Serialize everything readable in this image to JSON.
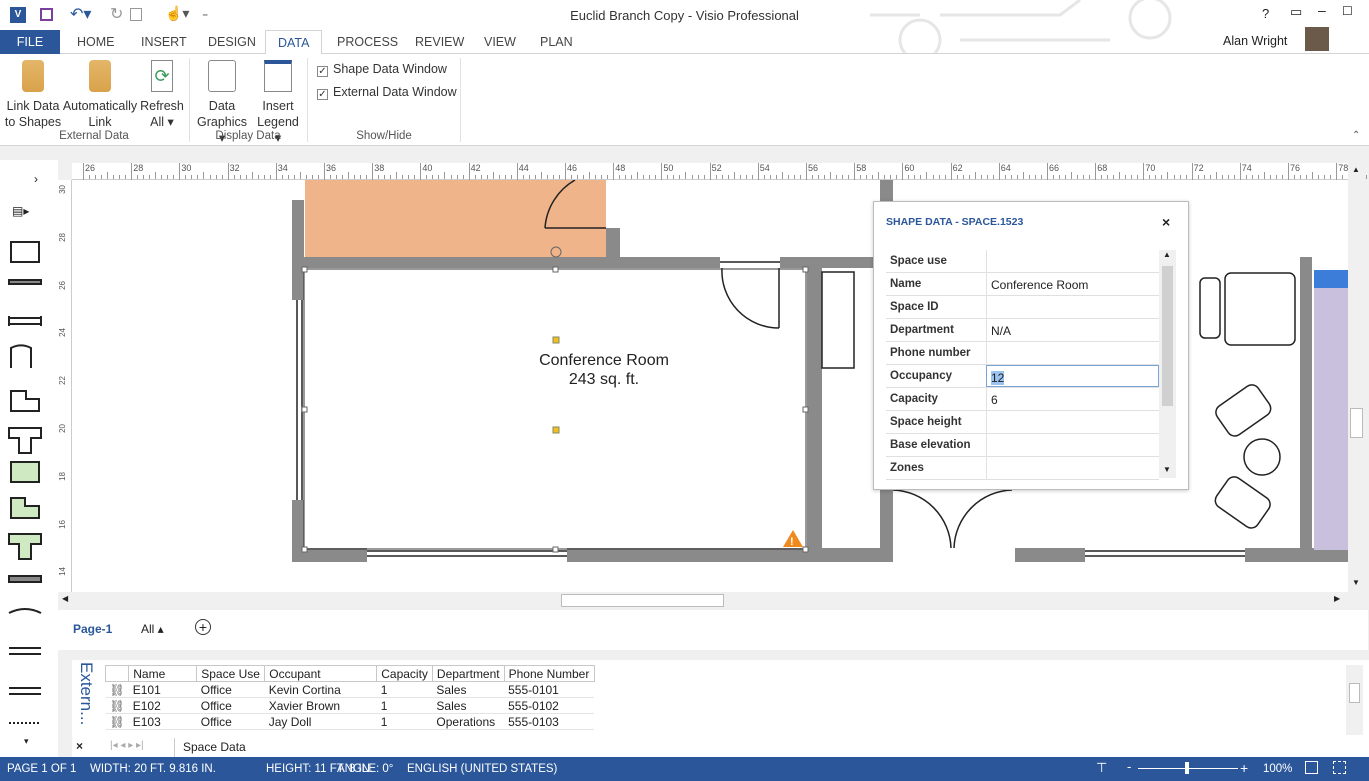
{
  "window": {
    "title": "Euclid Branch Copy - Visio Professional",
    "user": "Alan Wright",
    "help": "?"
  },
  "tabs": [
    {
      "label": "FILE"
    },
    {
      "label": "HOME"
    },
    {
      "label": "INSERT"
    },
    {
      "label": "DESIGN"
    },
    {
      "label": "DATA"
    },
    {
      "label": "PROCESS"
    },
    {
      "label": "REVIEW"
    },
    {
      "label": "VIEW"
    },
    {
      "label": "PLAN"
    }
  ],
  "active_tab": "DATA",
  "ribbon": {
    "link_data": [
      "Link Data",
      "to Shapes"
    ],
    "auto_link": [
      "Automatically",
      "Link"
    ],
    "refresh": [
      "Refresh",
      "All ▾"
    ],
    "data_graphics": [
      "Data",
      "Graphics ▾"
    ],
    "insert_legend": [
      "Insert",
      "Legend ▾"
    ],
    "shape_data_window": "Shape Data Window",
    "external_data_window": "External Data Window",
    "groups": [
      "External Data",
      "Display Data",
      "Show/Hide"
    ]
  },
  "rulers": {
    "h": [
      "26",
      "28",
      "30",
      "32",
      "34",
      "36",
      "38",
      "40",
      "42",
      "44",
      "46",
      "48",
      "50",
      "52",
      "54",
      "56",
      "58",
      "60",
      "62",
      "64",
      "66",
      "68",
      "70",
      "72",
      "74",
      "76",
      "78"
    ],
    "v": [
      "30",
      "28",
      "26",
      "24",
      "22",
      "20",
      "18",
      "16",
      "14"
    ]
  },
  "canvas": {
    "room_name": "Conference Room",
    "room_area": "243 sq. ft.",
    "room_fill": "#f0b48a",
    "purple_fill": "#c8c0dc",
    "wall_color": "#8a8a8a"
  },
  "shape_data": {
    "title": "SHAPE DATA - SPACE.1523",
    "rows": [
      {
        "label": "Space use",
        "value": ""
      },
      {
        "label": "Name",
        "value": "Conference Room"
      },
      {
        "label": "Space ID",
        "value": ""
      },
      {
        "label": "Department",
        "value": "N/A"
      },
      {
        "label": "Phone number",
        "value": ""
      },
      {
        "label": "Occupancy",
        "value": "12"
      },
      {
        "label": "Capacity",
        "value": "6"
      },
      {
        "label": "Space height",
        "value": ""
      },
      {
        "label": "Base elevation",
        "value": ""
      },
      {
        "label": "Zones",
        "value": ""
      }
    ]
  },
  "pages": {
    "page1": "Page-1",
    "all": "All ▴"
  },
  "external_data": {
    "title": "Extern...",
    "sheet_tab": "Space Data",
    "columns": [
      "Name",
      "Space Use",
      "Occupant",
      "Capacity",
      "Department",
      "Phone Number"
    ],
    "rows": [
      [
        "E101",
        "Office",
        "Kevin Cortina",
        "1",
        "Sales",
        "555-0101"
      ],
      [
        "E102",
        "Office",
        "Xavier Brown",
        "1",
        "Sales",
        "555-0102"
      ],
      [
        "E103",
        "Office",
        "Jay Doll",
        "1",
        "Operations",
        "555-0103"
      ]
    ]
  },
  "status": {
    "page": "PAGE 1 OF 1",
    "width": "WIDTH: 20 FT. 9.816 IN.",
    "height": "HEIGHT: 11 FT. 8 IN.",
    "angle": "ANGLE: 0°",
    "language": "ENGLISH (UNITED STATES)",
    "zoom": "100%",
    "zoom_level_percent": 100
  },
  "colors": {
    "accent": "#2b579a"
  }
}
